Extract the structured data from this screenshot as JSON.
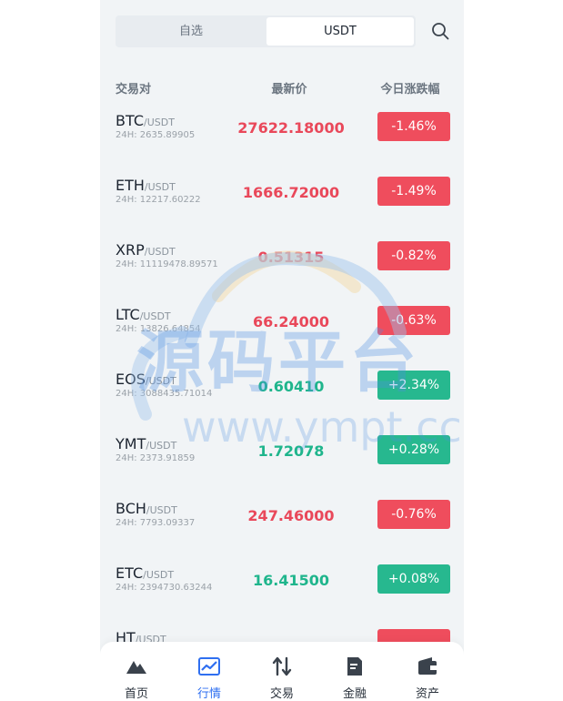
{
  "tabs": {
    "favorites": "自选",
    "usdt": "USDT"
  },
  "header": {
    "pair": "交易对",
    "price": "最新价",
    "change": "今日涨跌幅"
  },
  "rows": [
    {
      "symbol": "BTC",
      "quote": "/USDT",
      "vol": "24H: 2635.89905",
      "price": "27622.18000",
      "change": "-1.46%",
      "dir": "down"
    },
    {
      "symbol": "ETH",
      "quote": "/USDT",
      "vol": "24H: 12217.60222",
      "price": "1666.72000",
      "change": "-1.49%",
      "dir": "down"
    },
    {
      "symbol": "XRP",
      "quote": "/USDT",
      "vol": "24H: 11119478.89571",
      "price": "0.51315",
      "change": "-0.82%",
      "dir": "down"
    },
    {
      "symbol": "LTC",
      "quote": "/USDT",
      "vol": "24H: 13826.64854",
      "price": "66.24000",
      "change": "-0.63%",
      "dir": "down"
    },
    {
      "symbol": "EOS",
      "quote": "/USDT",
      "vol": "24H: 3088435.71014",
      "price": "0.60410",
      "change": "+2.34%",
      "dir": "up"
    },
    {
      "symbol": "YMT",
      "quote": "/USDT",
      "vol": "24H: 2373.91859",
      "price": "1.72078",
      "change": "+0.28%",
      "dir": "up"
    },
    {
      "symbol": "BCH",
      "quote": "/USDT",
      "vol": "24H: 7793.09337",
      "price": "247.46000",
      "change": "-0.76%",
      "dir": "down"
    },
    {
      "symbol": "ETC",
      "quote": "/USDT",
      "vol": "24H: 2394730.63244",
      "price": "16.41500",
      "change": "+0.08%",
      "dir": "up"
    },
    {
      "symbol": "HT",
      "quote": "/USDT",
      "vol": "",
      "price": "",
      "change": "",
      "dir": "down"
    }
  ],
  "watermark": {
    "text": "源码平台",
    "url": "www.ympt.cc"
  },
  "nav": [
    {
      "label": "首页",
      "icon": "home-mountain-icon",
      "active": false
    },
    {
      "label": "行情",
      "icon": "market-chart-icon",
      "active": true
    },
    {
      "label": "交易",
      "icon": "trade-arrows-icon",
      "active": false
    },
    {
      "label": "金融",
      "icon": "finance-document-icon",
      "active": false
    },
    {
      "label": "资产",
      "icon": "wallet-icon",
      "active": false
    }
  ],
  "colors": {
    "down": "#ef4d5d",
    "up": "#27b88f",
    "accent": "#2f6ff0"
  }
}
